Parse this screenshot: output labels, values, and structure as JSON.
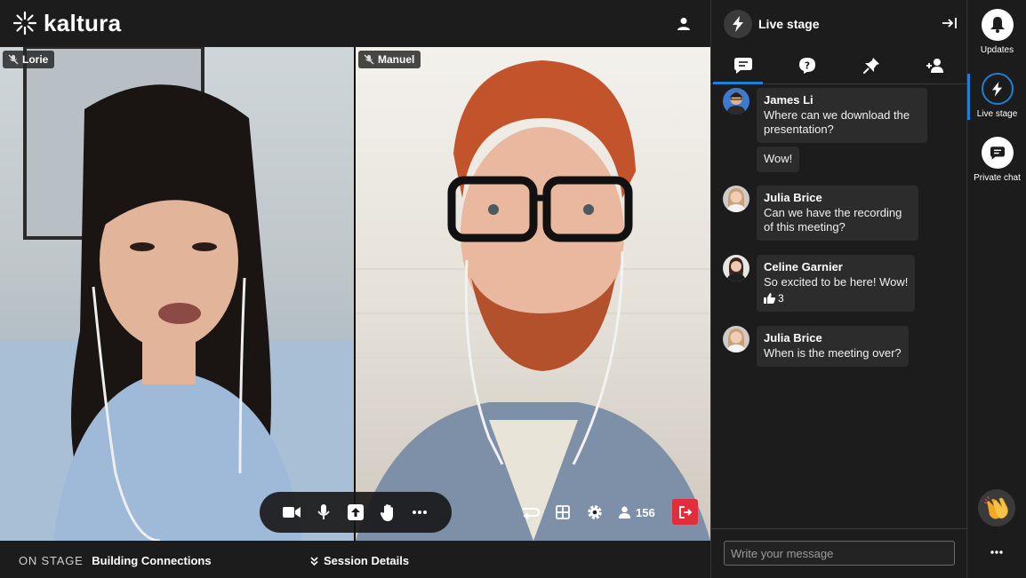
{
  "app": {
    "logo_text": "kaltura"
  },
  "video": {
    "tiles": [
      {
        "name": "Lorie"
      },
      {
        "name": "Manuel"
      }
    ],
    "viewer_count": "156"
  },
  "bottom": {
    "on_stage_label": "ON STAGE",
    "session_title": "Building Connections",
    "session_details": "Session Details"
  },
  "panel": {
    "title": "Live stage",
    "messages": [
      {
        "author": "James Li",
        "text": "Where can we download the presentation?"
      },
      {
        "author": "",
        "text": "Wow!"
      },
      {
        "author": "Julia Brice",
        "text": "Can we have the recording of this meeting?"
      },
      {
        "author": "Celine Garnier",
        "text": "So excited to be here! Wow!",
        "reaction_count": "3"
      },
      {
        "author": "Julia Brice",
        "text": "When is the meeting over?"
      }
    ],
    "input_placeholder": "Write your message"
  },
  "rail": {
    "items": [
      {
        "label": "Updates"
      },
      {
        "label": "Live stage"
      },
      {
        "label": "Private chat"
      }
    ]
  },
  "colors": {
    "accent": "#1e7fd8",
    "leave": "#e12e3d"
  }
}
